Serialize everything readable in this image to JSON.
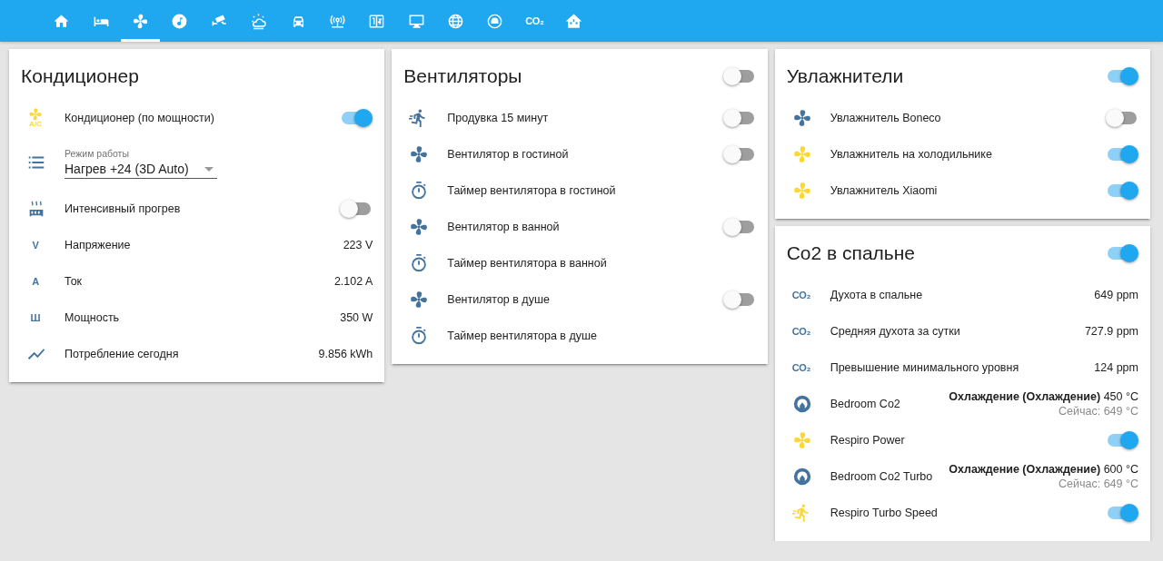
{
  "tabs": [
    {
      "kind": "home",
      "selected": false
    },
    {
      "kind": "bed",
      "selected": false
    },
    {
      "kind": "fan",
      "selected": true
    },
    {
      "kind": "music",
      "selected": false
    },
    {
      "kind": "cctv",
      "selected": false
    },
    {
      "kind": "weather",
      "selected": false
    },
    {
      "kind": "car",
      "selected": false
    },
    {
      "kind": "antenna",
      "selected": false
    },
    {
      "kind": "panel",
      "selected": false
    },
    {
      "kind": "monitor",
      "selected": false
    },
    {
      "kind": "globe",
      "selected": false
    },
    {
      "kind": "robot",
      "selected": false
    },
    {
      "kind": "text",
      "text": "CO₂",
      "selected": false
    },
    {
      "kind": "home-network",
      "selected": false
    }
  ],
  "columns": [
    [
      {
        "title": "Кондиционер",
        "rows": [
          {
            "kind": "toggle",
            "icon": {
              "kind": "ac",
              "text": "A/C"
            },
            "label": "Кондиционер (по мощности)",
            "on": true
          },
          {
            "kind": "select",
            "icon": {
              "kind": "list"
            },
            "label": "Режим работы",
            "value": "Нагрев +24 (3D Auto)"
          },
          {
            "kind": "toggle",
            "icon": {
              "kind": "radiator"
            },
            "label": "Интенсивный прогрев",
            "on": false
          },
          {
            "kind": "sensor",
            "icon": {
              "kind": "text",
              "text": "V"
            },
            "label": "Напряжение",
            "value": "223 V"
          },
          {
            "kind": "sensor",
            "icon": {
              "kind": "text",
              "text": "A"
            },
            "label": "Ток",
            "value": "2.102 A"
          },
          {
            "kind": "sensor",
            "icon": {
              "kind": "text",
              "text": "Ш"
            },
            "label": "Мощность",
            "value": "350 W"
          },
          {
            "kind": "sensor",
            "icon": {
              "kind": "chart"
            },
            "label": "Потребление сегодня",
            "value": "9.856 kWh"
          }
        ]
      }
    ],
    [
      {
        "title": "Вентиляторы",
        "header_toggle": {
          "on": false
        },
        "rows": [
          {
            "kind": "toggle",
            "icon": {
              "kind": "run"
            },
            "label": "Продувка 15 минут",
            "on": false
          },
          {
            "kind": "toggle",
            "icon": {
              "kind": "fan"
            },
            "label": "Вентилятор в гостиной",
            "on": false
          },
          {
            "kind": "text",
            "icon": {
              "kind": "timer"
            },
            "label": "Таймер вентилятора в гостиной"
          },
          {
            "kind": "toggle",
            "icon": {
              "kind": "fan"
            },
            "label": "Вентилятор в ванной",
            "on": false
          },
          {
            "kind": "text",
            "icon": {
              "kind": "timer"
            },
            "label": "Таймер вентилятора в ванной"
          },
          {
            "kind": "toggle",
            "icon": {
              "kind": "fan"
            },
            "label": "Вентилятор в душе",
            "on": false
          },
          {
            "kind": "text",
            "icon": {
              "kind": "timer"
            },
            "label": "Таймер вентилятора в душе"
          }
        ]
      }
    ],
    [
      {
        "title": "Увлажнители",
        "header_toggle": {
          "on": true
        },
        "rows": [
          {
            "kind": "toggle",
            "icon": {
              "kind": "fan"
            },
            "label": "Увлажнитель Boneco",
            "on": false
          },
          {
            "kind": "toggle",
            "icon": {
              "kind": "fan"
            },
            "label": "Увлажнитель на холодильнике",
            "on": true
          },
          {
            "kind": "toggle",
            "icon": {
              "kind": "fan"
            },
            "label": "Увлажнитель Xiaomi",
            "on": true
          }
        ]
      },
      {
        "title": "Co2 в спальне",
        "header_toggle": {
          "on": true
        },
        "rows": [
          {
            "kind": "sensor",
            "icon": {
              "kind": "text",
              "text": "CO₂"
            },
            "label": "Духота в спальне",
            "value": "649 ppm"
          },
          {
            "kind": "sensor",
            "icon": {
              "kind": "text",
              "text": "CO₂"
            },
            "label": "Средняя духота за сутки",
            "value": "727.9 ppm"
          },
          {
            "kind": "sensor",
            "icon": {
              "kind": "text",
              "text": "CO₂"
            },
            "label": "Превышение минимального уровня",
            "value": "124 ppm"
          },
          {
            "kind": "climate",
            "icon": {
              "kind": "gauge"
            },
            "label": "Bedroom Co2",
            "value": "**Охлаждение (Охлаждение)** 450 °C",
            "current": "Сейчас: 649 °C"
          },
          {
            "kind": "toggle",
            "icon": {
              "kind": "fan"
            },
            "label": "Respiro Power",
            "on": true
          },
          {
            "kind": "climate",
            "icon": {
              "kind": "gauge"
            },
            "label": "Bedroom Co2 Turbo",
            "value": "**Охлаждение (Охлаждение)** 600 °C",
            "current": "Сейчас: 649 °C"
          },
          {
            "kind": "toggle",
            "icon": {
              "kind": "run"
            },
            "label": "Respiro Turbo Speed",
            "on": true
          }
        ]
      }
    ]
  ]
}
